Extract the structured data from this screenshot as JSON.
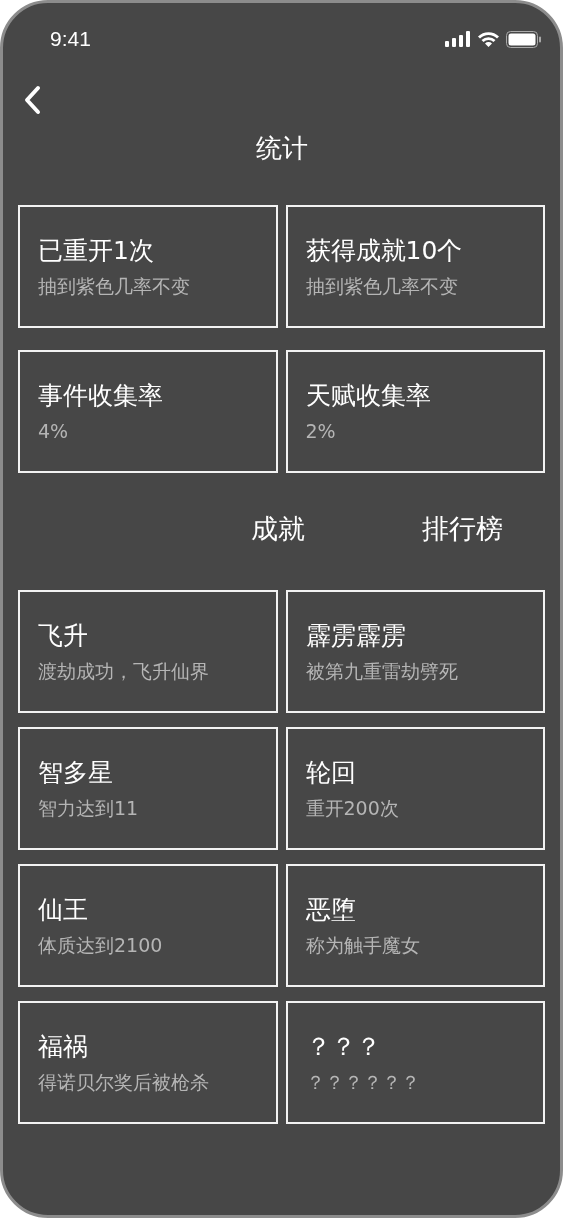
{
  "status_bar": {
    "time": "9:41"
  },
  "title": "统计",
  "stats": [
    {
      "title": "已重开1次",
      "subtitle": "抽到紫色几率不变"
    },
    {
      "title": "获得成就10个",
      "subtitle": "抽到紫色几率不变"
    },
    {
      "title": "事件收集率",
      "subtitle": "4%"
    },
    {
      "title": "天赋收集率",
      "subtitle": "2%"
    }
  ],
  "tabs": [
    {
      "label": "成就"
    },
    {
      "label": "排行榜"
    }
  ],
  "achievements": [
    {
      "title": "飞升",
      "subtitle": "渡劫成功，飞升仙界"
    },
    {
      "title": "霹雳霹雳",
      "subtitle": "被第九重雷劫劈死"
    },
    {
      "title": "智多星",
      "subtitle": "智力达到11"
    },
    {
      "title": "轮回",
      "subtitle": "重开200次"
    },
    {
      "title": "仙王",
      "subtitle": "体质达到2100"
    },
    {
      "title": "恶堕",
      "subtitle": "称为触手魔女"
    },
    {
      "title": "福祸",
      "subtitle": "得诺贝尔奖后被枪杀"
    },
    {
      "title": "？？？",
      "subtitle": "？？？？？？"
    }
  ]
}
